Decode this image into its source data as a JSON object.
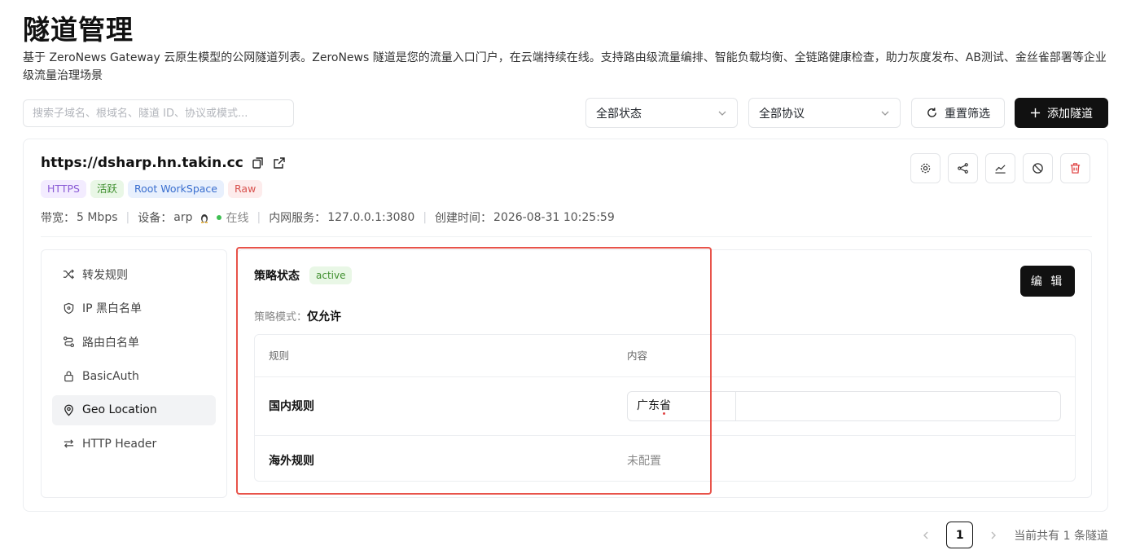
{
  "header": {
    "title": "隧道管理",
    "description": "基于 ZeroNews Gateway 云原生模型的公网隧道列表。ZeroNews 隧道是您的流量入口门户，在云端持续在线。支持路由级流量编排、智能负载均衡、全链路健康检查，助力灰度发布、AB测试、金丝雀部署等企业级流量治理场景"
  },
  "toolbar": {
    "search_placeholder": "搜索子域名、根域名、隧道 ID、协议或模式...",
    "status_select": "全部状态",
    "protocol_select": "全部协议",
    "reset_label": "重置筛选",
    "add_label": "添加隧道"
  },
  "tunnel": {
    "url": "https://dsharp.hn.takin.cc",
    "tags": [
      "HTTPS",
      "活跃",
      "Root WorkSpace",
      "Raw"
    ],
    "bandwidth_label": "带宽：",
    "bandwidth_value": "5 Mbps",
    "device_label": "设备：",
    "device_value": "arp",
    "online_text": "在线",
    "intranet_label": "内网服务：",
    "intranet_value": "127.0.0.1:3080",
    "created_label": "创建时间：",
    "created_value": "2026-08-31 10:25:59"
  },
  "sidebar": {
    "items": [
      {
        "label": "转发规则",
        "icon": "shuffle-icon"
      },
      {
        "label": "IP 黑白名单",
        "icon": "shield-icon"
      },
      {
        "label": "路由白名单",
        "icon": "route-icon"
      },
      {
        "label": "BasicAuth",
        "icon": "lock-icon"
      },
      {
        "label": "Geo Location",
        "icon": "location-pin-icon"
      },
      {
        "label": "HTTP Header",
        "icon": "swap-arrows-icon"
      }
    ],
    "active_index": 4
  },
  "policy": {
    "status_label": "策略状态",
    "status_value": "active",
    "mode_label": "策略模式：",
    "mode_value": "仅允许",
    "edit_label": "编 辑",
    "columns": [
      "规则",
      "内容"
    ],
    "rows": [
      {
        "name": "国内规则",
        "value": "广东省"
      },
      {
        "name": "海外规则",
        "value": "未配置"
      }
    ]
  },
  "pagination": {
    "current_page": "1",
    "total_text": "当前共有 1 条隧道"
  },
  "colors": {
    "accent": "#111111",
    "highlight": "#e8534a",
    "online": "#3fbf52"
  }
}
